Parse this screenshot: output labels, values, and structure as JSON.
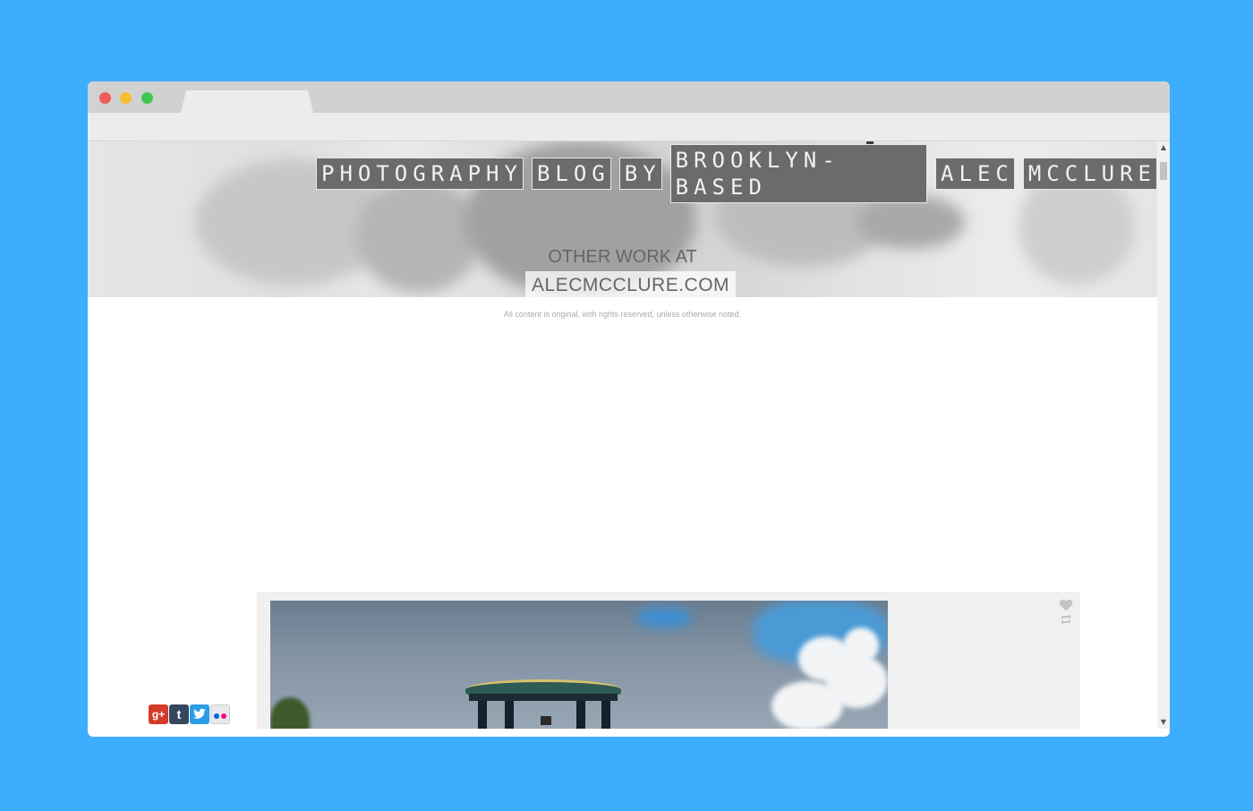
{
  "blog": {
    "title_words": [
      "PHOTOGRAPHY",
      "BLOG",
      "BY",
      "BROOKLYN-BASED",
      "ALEC",
      "MCCLURE"
    ],
    "other_work_label": "OTHER WORK AT",
    "site_link": "ALECMCCLURE.COM",
    "rights_notice": "All content is original, with rights reserved, unless otherwise noted."
  },
  "social": [
    {
      "name": "google-plus",
      "glyph": "g+"
    },
    {
      "name": "tumblr",
      "glyph": "t"
    },
    {
      "name": "twitter",
      "glyph": "🐦"
    },
    {
      "name": "flickr",
      "glyph": ""
    }
  ],
  "post_actions": {
    "like_icon": "heart-icon",
    "reblog_icon": "reblog-icon"
  },
  "colors": {
    "desktop_background": "#3daefe",
    "title_block": "#6b6b6b",
    "post_background": "#f0f0f0"
  }
}
